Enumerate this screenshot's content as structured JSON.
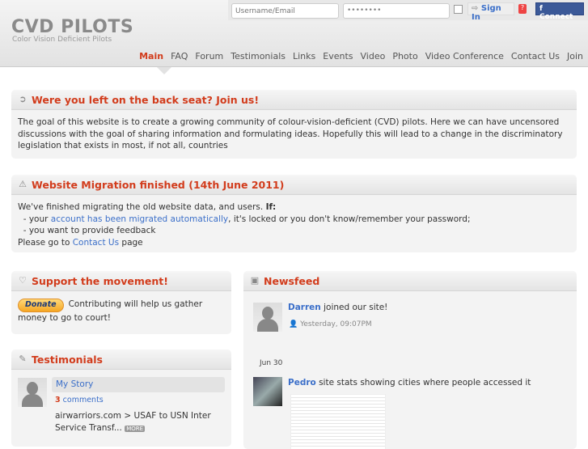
{
  "header": {
    "logo": "CVD PILOTS",
    "tagline": "Color Vision Deficient Pilots"
  },
  "login": {
    "username_placeholder": "Username/Email",
    "password_value": "••••••••",
    "signin": "Sign In",
    "help": "?",
    "facebook": "Connect"
  },
  "nav": [
    "Main",
    "FAQ",
    "Forum",
    "Testimonials",
    "Links",
    "Events",
    "Video",
    "Photo",
    "Video Conference",
    "Contact Us",
    "Join"
  ],
  "welcome": {
    "title": "Were you left on the back seat? Join us!",
    "body": "The goal of this website is to create a growing community of colour-vision-deficient (CVD) pilots. Here we can have uncensored discussions with the goal of sharing information and formulating ideas. Hopefully this will lead to a change in the discriminatory legislation that exists in most, if not all, countries"
  },
  "migration": {
    "title": "Website Migration finished (14th June 2011)",
    "line1": "We've finished migrating the old website data, and users.",
    "if": "If:",
    "l2a": "- your ",
    "l2link": "account has been migrated automatically",
    "l2b": ", it's locked or you don't know/remember your password;",
    "l3": "- you want to provide feedback",
    "l4a": "Please go to ",
    "l4link": "Contact Us",
    "l4b": " page"
  },
  "support": {
    "title": "Support the movement!",
    "donate": "Donate",
    "text": "Contributing will help us gather money to go to court!"
  },
  "testimonials": {
    "title": "Testimonials",
    "item_title": "My Story",
    "comments_count": "3",
    "comments_label": "comments",
    "excerpt": "airwarriors.com > USAF to USN Inter Service Transf...",
    "more": "MORE"
  },
  "newsfeed": {
    "title": "Newsfeed",
    "items": [
      {
        "user": "Darren",
        "text": "joined our site!",
        "time": "Yesterday, 09:07PM"
      },
      {
        "user": "Pedro",
        "text": "site stats showing cities where people accessed it"
      }
    ],
    "date": "Jun 30"
  }
}
